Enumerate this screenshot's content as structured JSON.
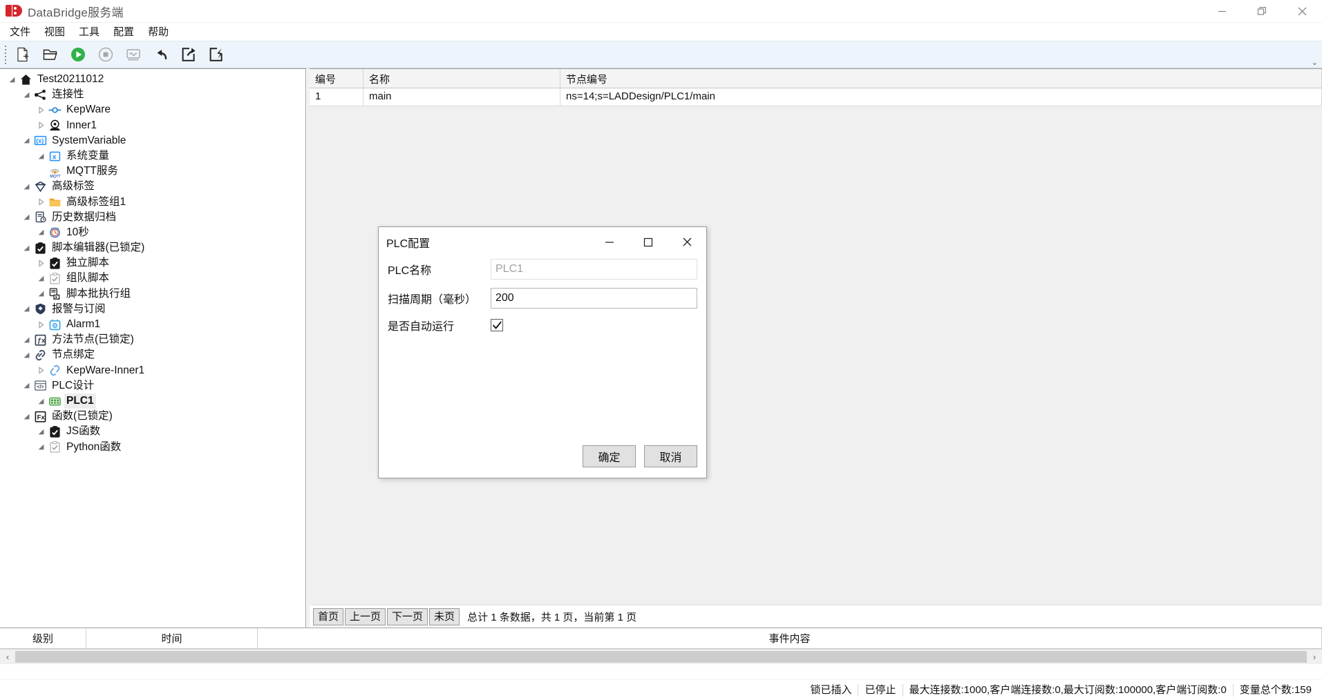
{
  "window": {
    "title": "DataBridge服务端",
    "logo_color": "#d4262c",
    "controls": [
      {
        "name": "minimize",
        "glyph": "minimize-icon"
      },
      {
        "name": "restore",
        "glyph": "restore-icon"
      },
      {
        "name": "close",
        "glyph": "close-icon"
      }
    ]
  },
  "menubar": {
    "items": [
      {
        "label": "文件"
      },
      {
        "label": "视图"
      },
      {
        "label": "工具"
      },
      {
        "label": "配置"
      },
      {
        "label": "帮助"
      }
    ]
  },
  "toolbar": {
    "overflow_label": "⌄",
    "buttons": [
      {
        "icon": "new-file-icon",
        "title": "新建"
      },
      {
        "icon": "open-folder-icon",
        "title": "打开"
      },
      {
        "icon": "play-icon",
        "title": "启动",
        "color": "#2aa84a"
      },
      {
        "icon": "stop-icon",
        "title": "停止",
        "color": "#9a9a9a"
      },
      {
        "icon": "monitor-wave-icon",
        "title": "监视",
        "color": "#9a9a9a"
      },
      {
        "icon": "undo-arrow-icon",
        "title": "撤销"
      },
      {
        "icon": "export-icon",
        "title": "导出"
      },
      {
        "icon": "import-icon",
        "title": "导入"
      }
    ]
  },
  "tree": {
    "nodes": [
      {
        "label": "Test20211012",
        "indent": 0,
        "twist": "open",
        "icon": "home-icon",
        "selected": false
      },
      {
        "label": "连接性",
        "indent": 1,
        "twist": "open",
        "icon": "share-nodes-icon",
        "selected": false
      },
      {
        "label": "KepWare",
        "indent": 2,
        "twist": "closed",
        "icon": "connector-icon",
        "selected": false
      },
      {
        "label": "Inner1",
        "indent": 2,
        "twist": "closed",
        "icon": "inner-node-icon",
        "selected": false
      },
      {
        "label": "SystemVariable",
        "indent": 1,
        "twist": "open",
        "icon": "variable-x-icon",
        "selected": false
      },
      {
        "label": "系统变量",
        "indent": 2,
        "twist": "open",
        "icon": "variable-box-icon",
        "selected": false
      },
      {
        "label": "MQTT服务",
        "indent": 2,
        "twist": "none",
        "icon": "mqtt-icon",
        "selected": false
      },
      {
        "label": "高级标签",
        "indent": 1,
        "twist": "open",
        "icon": "diamond-icon",
        "selected": false
      },
      {
        "label": "高级标签组1",
        "indent": 2,
        "twist": "closed",
        "icon": "folder-icon",
        "selected": false
      },
      {
        "label": "历史数据归档",
        "indent": 1,
        "twist": "open",
        "icon": "archive-icon",
        "selected": false
      },
      {
        "label": "10秒",
        "indent": 2,
        "twist": "open",
        "icon": "clock-icon",
        "selected": false
      },
      {
        "label": "脚本编辑器(已锁定)",
        "indent": 1,
        "twist": "open",
        "icon": "clipboard-dark-icon",
        "selected": false
      },
      {
        "label": "独立脚本",
        "indent": 2,
        "twist": "closed",
        "icon": "clipboard-dark-icon",
        "selected": false
      },
      {
        "label": "组队脚本",
        "indent": 2,
        "twist": "open",
        "icon": "clipboard-light-icon",
        "selected": false
      },
      {
        "label": "脚本批执行组",
        "indent": 2,
        "twist": "open",
        "icon": "batch-script-icon",
        "selected": false
      },
      {
        "label": "报警与订阅",
        "indent": 1,
        "twist": "open",
        "icon": "shield-icon",
        "selected": false
      },
      {
        "label": "Alarm1",
        "indent": 2,
        "twist": "closed",
        "icon": "alarm-icon",
        "selected": false
      },
      {
        "label": "方法节点(已锁定)",
        "indent": 1,
        "twist": "open",
        "icon": "method-fx-icon",
        "selected": false
      },
      {
        "label": "节点绑定",
        "indent": 1,
        "twist": "open",
        "icon": "link-icon",
        "selected": false
      },
      {
        "label": "KepWare-Inner1",
        "indent": 2,
        "twist": "closed",
        "icon": "link-blue-icon",
        "selected": false
      },
      {
        "label": "PLC设计",
        "indent": 1,
        "twist": "open",
        "icon": "code-window-icon",
        "selected": false
      },
      {
        "label": "PLC1",
        "indent": 2,
        "twist": "open",
        "icon": "plc-green-icon",
        "selected": true
      },
      {
        "label": "函数(已锁定)",
        "indent": 1,
        "twist": "open",
        "icon": "fx-icon",
        "selected": false
      },
      {
        "label": "JS函数",
        "indent": 2,
        "twist": "open",
        "icon": "clipboard-dark-icon",
        "selected": false
      },
      {
        "label": "Python函数",
        "indent": 2,
        "twist": "open",
        "icon": "clipboard-light-icon",
        "selected": false
      }
    ]
  },
  "grid": {
    "columns": [
      "编号",
      "名称",
      "节点编号"
    ],
    "rows": [
      {
        "id": "1",
        "name": "main",
        "node_id": "ns=14;s=LADDesign/PLC1/main"
      }
    ]
  },
  "pager": {
    "first_label": "首页",
    "prev_label": "上一页",
    "next_label": "下一页",
    "last_label": "未页",
    "info": "总计 1 条数据，共 1 页，当前第 1 页"
  },
  "log": {
    "columns": [
      "级别",
      "时间",
      "事件内容"
    ],
    "rows": []
  },
  "statusbar": {
    "segments": [
      "锁已插入",
      "已停止",
      "最大连接数:1000,客户端连接数:0,最大订阅数:100000,客户端订阅数:0",
      "变量总个数:159"
    ]
  },
  "dialog": {
    "title": "PLC配置",
    "controls": [
      {
        "name": "minimize",
        "glyph": "minimize-icon"
      },
      {
        "name": "maximize",
        "glyph": "maximize-icon"
      },
      {
        "name": "close",
        "glyph": "close-icon"
      }
    ],
    "fields": {
      "name_label": "PLC名称",
      "name_value": "PLC1",
      "cycle_label": "扫描周期（毫秒）",
      "cycle_value": "200",
      "autorun_label": "是否自动运行",
      "autorun_checked": true,
      "check_glyph": "✔"
    },
    "ok_label": "确定",
    "cancel_label": "取消"
  }
}
